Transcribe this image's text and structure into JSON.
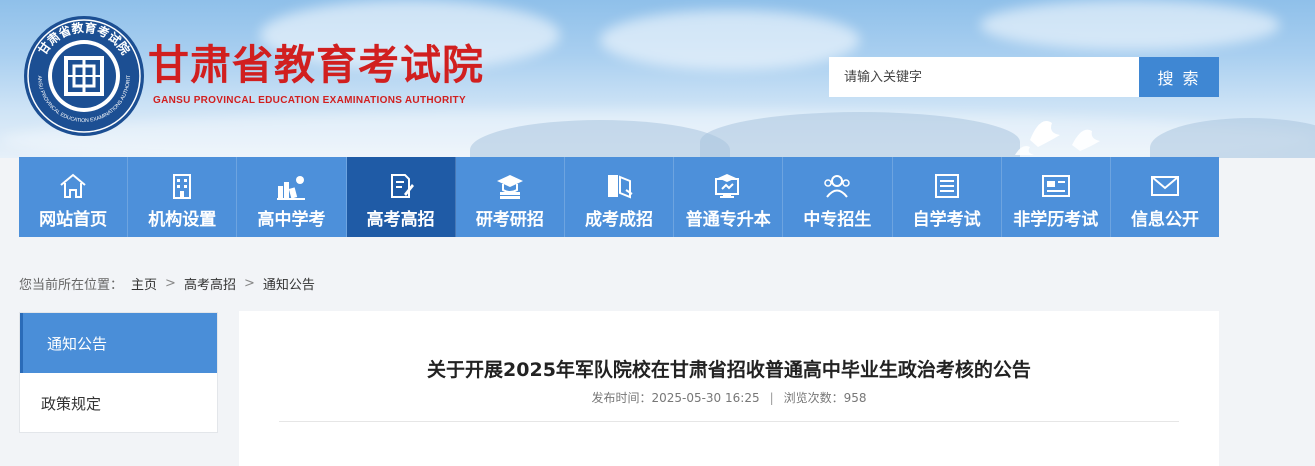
{
  "header": {
    "title": "甘肃省教育考试院",
    "subtitle": "GANSU PROVINCAL EDUCATION EXAMINATIONS AUTHORITY",
    "emblem_text": "甘肃省教育考试院",
    "emblem_sub": "GANSU PROVINCAL EDUCATION EXAMINATIONS AUTHORITY"
  },
  "search": {
    "placeholder": "请输入关键字",
    "button_label": "搜 索"
  },
  "nav": {
    "items": [
      {
        "label": "网站首页",
        "icon": "home-icon"
      },
      {
        "label": "机构设置",
        "icon": "building-icon"
      },
      {
        "label": "高中学考",
        "icon": "books-icon"
      },
      {
        "label": "高考高招",
        "icon": "pen-document-icon"
      },
      {
        "label": "研考研招",
        "icon": "graduation-cap-icon"
      },
      {
        "label": "成考成招",
        "icon": "book-open-icon"
      },
      {
        "label": "普通专升本",
        "icon": "monitor-cap-icon"
      },
      {
        "label": "中专招生",
        "icon": "users-icon"
      },
      {
        "label": "自学考试",
        "icon": "list-document-icon"
      },
      {
        "label": "非学历考试",
        "icon": "id-card-icon"
      },
      {
        "label": "信息公开",
        "icon": "mail-icon"
      }
    ],
    "active_index": 3
  },
  "breadcrumb": {
    "prefix": "您当前所在位置：",
    "items": [
      "主页",
      "高考高招",
      "通知公告"
    ],
    "separator": ">"
  },
  "sidebar": {
    "items": [
      {
        "label": "通知公告"
      },
      {
        "label": "政策规定"
      }
    ]
  },
  "article": {
    "title": "关于开展2025年军队院校在甘肃省招收普通高中毕业生政治考核的公告",
    "publish_time": "发布时间：2025-05-30 16:25",
    "separator": "|",
    "views": "浏览次数：958"
  },
  "colors": {
    "brand_red": "#d11f1f",
    "nav_blue": "#4d90da",
    "nav_active": "#1f5ba6",
    "search_button": "#3f87d3"
  }
}
